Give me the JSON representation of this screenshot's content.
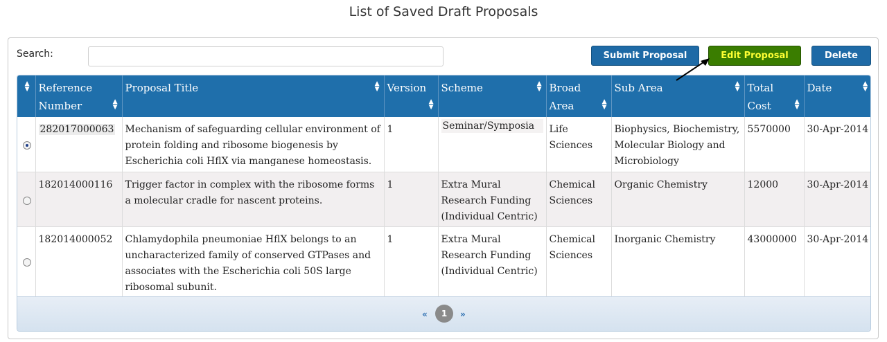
{
  "page": {
    "title": "List of Saved Draft Proposals"
  },
  "toolbar": {
    "search_label": "Search:",
    "search_value": "",
    "submit_label": "Submit Proposal",
    "edit_label": "Edit Proposal",
    "delete_label": "Delete"
  },
  "table": {
    "headers": {
      "reference": "Reference Number",
      "title": "Proposal Title",
      "version": "Version",
      "scheme": "Scheme",
      "broad_area": "Broad Area",
      "sub_area": "Sub Area",
      "total_cost": "Total Cost",
      "date": "Date"
    },
    "rows": [
      {
        "selected": true,
        "reference": "282017000063",
        "title": "Mechanism of safeguarding cellular environment of protein folding and ribosome biogenesis by Escherichia coli HflX via manganese homeostasis.",
        "version": "1",
        "scheme": "Seminar/Symposia",
        "broad_area": "Life Sciences",
        "sub_area": "Biophysics, Biochemistry, Molecular Biology and Microbiology",
        "total_cost": "5570000",
        "date": "30-Apr-2014"
      },
      {
        "selected": false,
        "reference": "182014000116",
        "title": "Trigger factor in complex with the ribosome forms a molecular cradle for nascent proteins.",
        "version": "1",
        "scheme": "Extra Mural Research Funding (Individual Centric)",
        "broad_area": "Chemical Sciences",
        "sub_area": "Organic Chemistry",
        "total_cost": "12000",
        "date": "30-Apr-2014"
      },
      {
        "selected": false,
        "reference": "182014000052",
        "title": "Chlamydophila pneumoniae HflX belongs to an uncharacterized family of conserved GTPases and associates with the Escherichia coli 50S large ribosomal subunit.",
        "version": "1",
        "scheme": "Extra Mural Research Funding (Individual Centric)",
        "broad_area": "Chemical Sciences",
        "sub_area": "Inorganic Chemistry",
        "total_cost": "43000000",
        "date": "30-Apr-2014"
      }
    ]
  },
  "pager": {
    "prev": "«",
    "page": "1",
    "next": "»"
  },
  "colors": {
    "header_bg": "#1f6fab",
    "primary_button": "#1e6aa6",
    "edit_button": "#3a7d00",
    "edit_text": "#ffff33"
  }
}
